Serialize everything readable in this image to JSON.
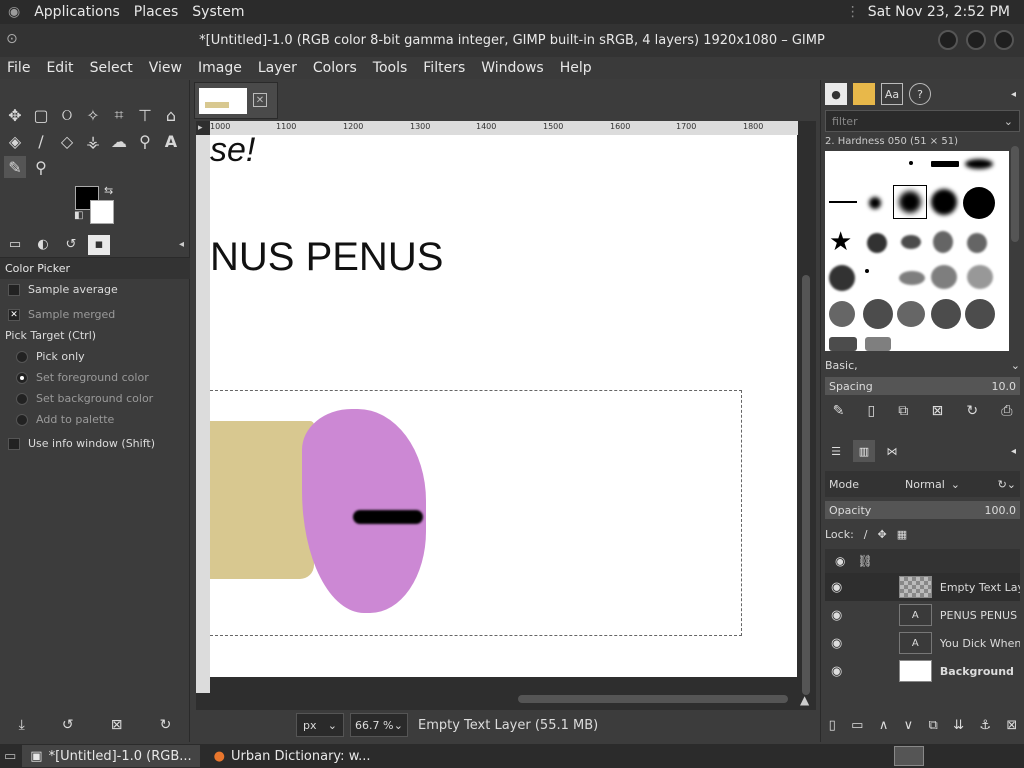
{
  "topbar": {
    "menu": [
      "Applications",
      "Places",
      "System"
    ],
    "clock": "Sat Nov 23,  2:52 PM"
  },
  "window": {
    "title": "*[Untitled]-1.0 (RGB color 8-bit gamma integer, GIMP built-in sRGB, 4 layers) 1920x1080 – GIMP"
  },
  "menubar": [
    "File",
    "Edit",
    "Select",
    "View",
    "Image",
    "Layer",
    "Colors",
    "Tools",
    "Filters",
    "Windows",
    "Help"
  ],
  "tool_options": {
    "title": "Color Picker",
    "sample_average": "Sample average",
    "sample_merged": "Sample merged",
    "pick_target": "Pick Target  (Ctrl)",
    "pick_only": "Pick only",
    "set_fg": "Set foreground color",
    "set_bg": "Set background color",
    "add_palette": "Add to palette",
    "use_info": "Use info window  (Shift)"
  },
  "ruler_marks": [
    "1000",
    "1100",
    "1200",
    "1300",
    "1400",
    "1500",
    "1600",
    "1700",
    "1800"
  ],
  "canvas": {
    "text_top": "se!",
    "text_mid": "NUS PENUS"
  },
  "status": {
    "unit": "px",
    "zoom": "66.7 %",
    "message": "Empty Text Layer (55.1 MB)"
  },
  "brushes": {
    "filter_placeholder": "filter",
    "name": "2. Hardness 050 (51 × 51)",
    "tag": "Basic,",
    "spacing_label": "Spacing",
    "spacing_value": "10.0"
  },
  "layers": {
    "mode_label": "Mode",
    "mode_value": "Normal",
    "opacity_label": "Opacity",
    "opacity_value": "100.0",
    "lock_label": "Lock:",
    "items": [
      {
        "name": "Empty Text Layer",
        "thumb": "checker"
      },
      {
        "name": "PENUS PENUS P",
        "thumb": "text"
      },
      {
        "name": "You Dick When Y",
        "thumb": "text"
      },
      {
        "name": "Background",
        "thumb": "white"
      }
    ]
  },
  "taskbar": {
    "items": [
      "*[Untitled]-1.0 (RGB...",
      "Urban Dictionary: w..."
    ]
  }
}
